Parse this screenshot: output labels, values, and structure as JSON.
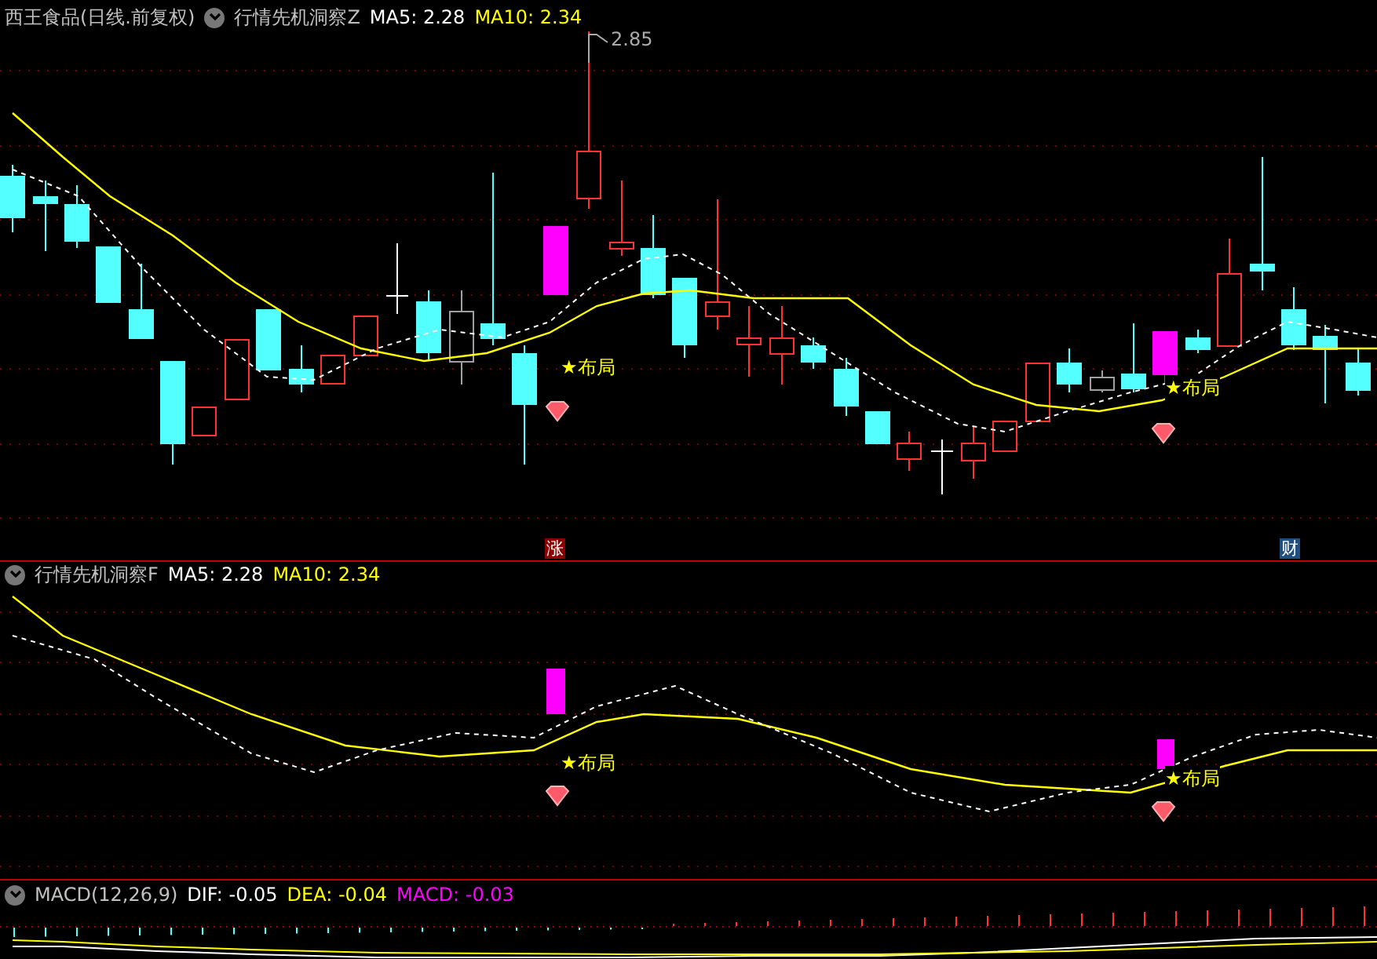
{
  "main_panel": {
    "title": "西王食品(日线.前复权)",
    "legend": [
      {
        "text": "行情先机洞察Z",
        "color": "#c0c0c0"
      },
      {
        "text": "MA5: 2.28",
        "color": "#ffffff"
      },
      {
        "text": "MA10: 2.34",
        "color": "#ffff00"
      }
    ],
    "high_label": "2.85",
    "signals": [
      {
        "label": "★布局"
      },
      {
        "label": "★布局"
      }
    ],
    "badges": [
      {
        "text": "涨",
        "color": "#8b0000"
      },
      {
        "text": "财",
        "color": "#1f4f7f"
      }
    ]
  },
  "indicator_panel": {
    "legend": [
      {
        "text": "行情先机洞察F",
        "color": "#c0c0c0"
      },
      {
        "text": "MA5: 2.28",
        "color": "#ffffff"
      },
      {
        "text": "MA10: 2.34",
        "color": "#ffff00"
      }
    ],
    "signals": [
      {
        "label": "★布局"
      },
      {
        "label": "★布局"
      }
    ]
  },
  "macd_panel": {
    "legend": [
      {
        "text": "MACD(12,26,9)",
        "color": "#c0c0c0"
      },
      {
        "text": "DIF: -0.05",
        "color": "#ffffff"
      },
      {
        "text": "DEA: -0.04",
        "color": "#ffff00"
      },
      {
        "text": "MACD: -0.03",
        "color": "#ff00ff"
      }
    ]
  }
}
